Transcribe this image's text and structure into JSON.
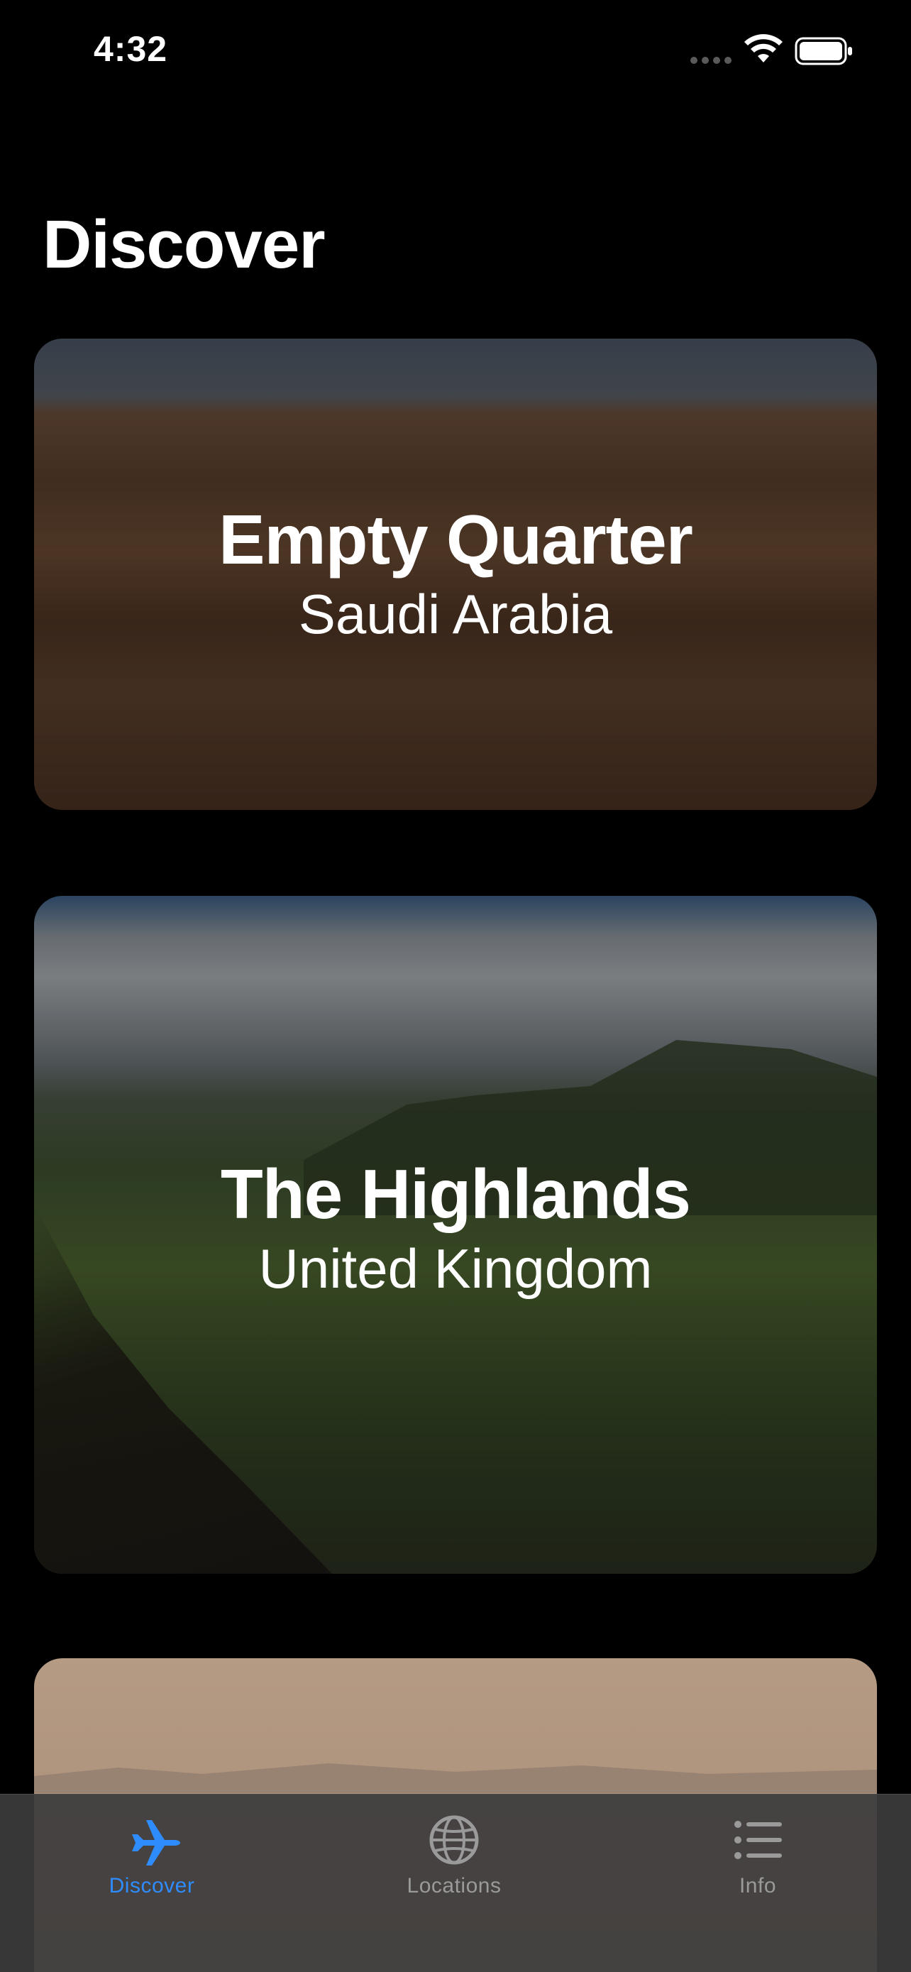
{
  "status_bar": {
    "time": "4:32"
  },
  "page": {
    "title": "Discover"
  },
  "cards": [
    {
      "title": "Empty Quarter",
      "subtitle": "Saudi Arabia"
    },
    {
      "title": "The Highlands",
      "subtitle": "United Kingdom"
    },
    {
      "title": "",
      "subtitle": ""
    }
  ],
  "tab_bar": {
    "tabs": [
      {
        "label": "Discover",
        "icon": "airplane-icon",
        "selected": true
      },
      {
        "label": "Locations",
        "icon": "globe-icon",
        "selected": false
      },
      {
        "label": "Info",
        "icon": "list-icon",
        "selected": false
      }
    ],
    "accent_color": "#2f8cff",
    "inactive_color": "#9a9a9a"
  }
}
